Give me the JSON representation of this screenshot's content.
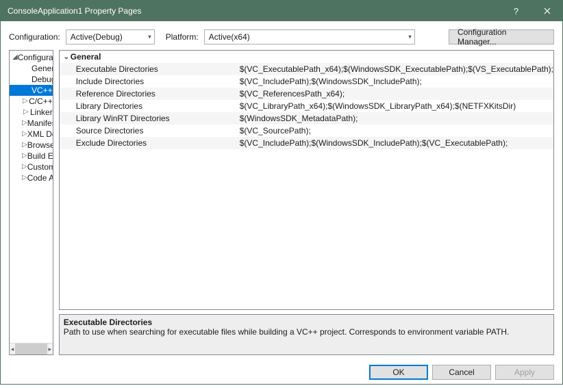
{
  "titlebar": {
    "title": "ConsoleApplication1 Property Pages"
  },
  "toolbar": {
    "configLabel": "Configuration:",
    "configValue": "Active(Debug)",
    "platformLabel": "Platform:",
    "platformValue": "Active(x64)",
    "managerLabel": "Configuration Manager..."
  },
  "tree": {
    "root": "Configuration Properties",
    "items": [
      {
        "label": "General",
        "expander": ""
      },
      {
        "label": "Debugging",
        "expander": ""
      },
      {
        "label": "VC++ Directories",
        "expander": "",
        "selected": true
      },
      {
        "label": "C/C++",
        "expander": "▷"
      },
      {
        "label": "Linker",
        "expander": "▷"
      },
      {
        "label": "Manifest Tool",
        "expander": "▷"
      },
      {
        "label": "XML Document Generator",
        "expander": "▷"
      },
      {
        "label": "Browse Information",
        "expander": "▷"
      },
      {
        "label": "Build Events",
        "expander": "▷"
      },
      {
        "label": "Custom Build Step",
        "expander": "▷"
      },
      {
        "label": "Code Analysis",
        "expander": "▷"
      }
    ]
  },
  "grid": {
    "category": "General",
    "rows": [
      {
        "name": "Executable Directories",
        "value": "$(VC_ExecutablePath_x64);$(WindowsSDK_ExecutablePath);$(VS_ExecutablePath);"
      },
      {
        "name": "Include Directories",
        "value": "$(VC_IncludePath);$(WindowsSDK_IncludePath);"
      },
      {
        "name": "Reference Directories",
        "value": "$(VC_ReferencesPath_x64);"
      },
      {
        "name": "Library Directories",
        "value": "$(VC_LibraryPath_x64);$(WindowsSDK_LibraryPath_x64);$(NETFXKitsDir)"
      },
      {
        "name": "Library WinRT Directories",
        "value": "$(WindowsSDK_MetadataPath);"
      },
      {
        "name": "Source Directories",
        "value": "$(VC_SourcePath);"
      },
      {
        "name": "Exclude Directories",
        "value": "$(VC_IncludePath);$(WindowsSDK_IncludePath);$(VC_ExecutablePath);"
      }
    ]
  },
  "desc": {
    "title": "Executable Directories",
    "body": "Path to use when searching for executable files while building a VC++ project.  Corresponds to environment variable PATH."
  },
  "footer": {
    "ok": "OK",
    "cancel": "Cancel",
    "apply": "Apply"
  }
}
